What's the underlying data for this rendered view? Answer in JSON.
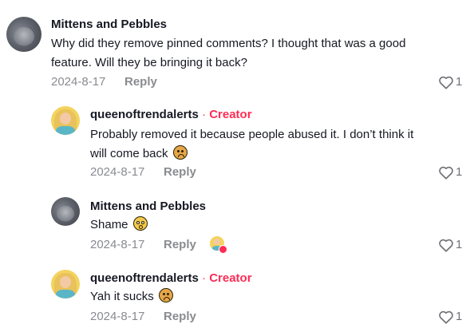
{
  "comments": [
    {
      "username": "Mittens and Pebbles",
      "is_creator": false,
      "text_lines": [
        "Why did they remove pinned comments? I thought that was a good",
        "feature. Will they be bringing it back?"
      ],
      "emoji": "",
      "date": "2024-8-17",
      "reply_label": "Reply",
      "likes": "1"
    },
    {
      "username": "queenoftrendalerts",
      "is_creator": true,
      "creator_sep": "·",
      "creator_label": "Creator",
      "text_lines": [
        "Probably removed it because people abused it. I don’t think it",
        "will come back"
      ],
      "emoji": "sad-face",
      "date": "2024-8-17",
      "reply_label": "Reply",
      "likes": "1"
    },
    {
      "username": "Mittens and Pebbles",
      "is_creator": false,
      "text_lines": [
        "Shame"
      ],
      "emoji": "flushed-face",
      "date": "2024-8-17",
      "reply_label": "Reply",
      "likes": "1",
      "liked_by_creator": true
    },
    {
      "username": "queenoftrendalerts",
      "is_creator": true,
      "creator_sep": "·",
      "creator_label": "Creator",
      "text_lines": [
        "Yah it sucks"
      ],
      "emoji": "sad-face",
      "date": "2024-8-17",
      "reply_label": "Reply",
      "likes": "1"
    }
  ],
  "colors": {
    "creator_accent": "#fe2c55",
    "meta_gray": "#8a8b91",
    "text": "#161823"
  }
}
